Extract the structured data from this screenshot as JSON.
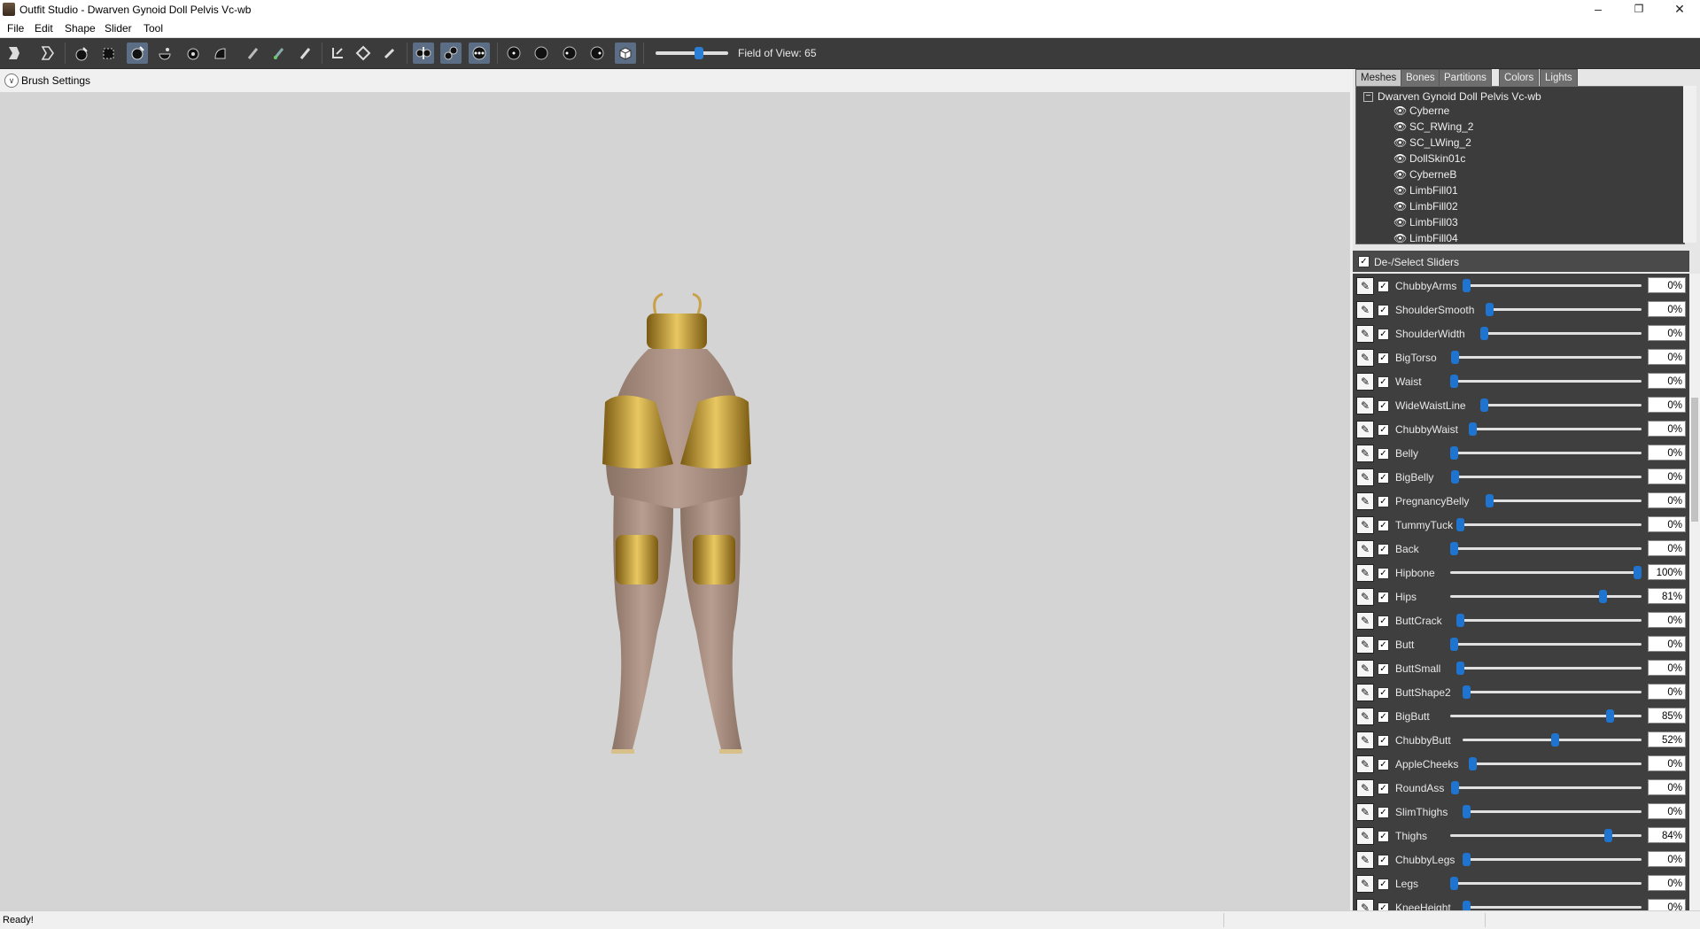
{
  "window": {
    "title": "Outfit Studio - Dwarven Gynoid Doll Pelvis Vc-wb",
    "minimize": "–",
    "maximize": "❐",
    "close": "✕"
  },
  "menu": [
    "File",
    "Edit",
    "Shape",
    "Slider",
    "Tool"
  ],
  "toolbar": {
    "fov_label": "Field of View: 65",
    "fov_value": 65,
    "tools": [
      "new-project-icon",
      "open-project-icon",
      "select-icon",
      "mask-icon",
      "inflate-icon",
      "deflate-icon",
      "move-brush-icon",
      "smooth-icon",
      "weight-paint-icon",
      "color-paint-icon",
      "alpha-paint-icon",
      "transform-icon",
      "pivot-icon",
      "vertex-select-icon",
      "x-mirror-icon",
      "connected-icon",
      "global-brush-icon",
      "wireframe-icon",
      "lighting-icon",
      "texture-icon",
      "shadeless-icon",
      "bone-view-icon"
    ]
  },
  "brush_settings_label": "Brush Settings",
  "tabs": [
    {
      "label": "Meshes",
      "active": true
    },
    {
      "label": "Bones",
      "active": false
    },
    {
      "label": "Partitions",
      "active": false
    },
    {
      "label": "Colors",
      "active": false
    },
    {
      "label": "Lights",
      "active": false
    }
  ],
  "mesh_tree": {
    "root": "Dwarven Gynoid Doll Pelvis Vc-wb",
    "items": [
      "Cyberne",
      "SC_RWing_2",
      "SC_LWing_2",
      "DollSkin01c",
      "CyberneB",
      "LimbFill01",
      "LimbFill02",
      "LimbFill03",
      "LimbFill04"
    ]
  },
  "sliders_header": "De-/Select Sliders",
  "sliders": [
    {
      "name": "ChubbyArms",
      "value": 0,
      "display": "0%"
    },
    {
      "name": "ShoulderSmooth",
      "value": 0,
      "display": "0%"
    },
    {
      "name": "ShoulderWidth",
      "value": 0,
      "display": "0%"
    },
    {
      "name": "BigTorso",
      "value": 0,
      "display": "0%"
    },
    {
      "name": "Waist",
      "value": 0,
      "display": "0%"
    },
    {
      "name": "WideWaistLine",
      "value": 0,
      "display": "0%"
    },
    {
      "name": "ChubbyWaist",
      "value": 0,
      "display": "0%"
    },
    {
      "name": "Belly",
      "value": 0,
      "display": "0%"
    },
    {
      "name": "BigBelly",
      "value": 0,
      "display": "0%"
    },
    {
      "name": "PregnancyBelly",
      "value": 0,
      "display": "0%"
    },
    {
      "name": "TummyTuck",
      "value": 0,
      "display": "0%"
    },
    {
      "name": "Back",
      "value": 0,
      "display": "0%"
    },
    {
      "name": "Hipbone",
      "value": 100,
      "display": "100%"
    },
    {
      "name": "Hips",
      "value": 81,
      "display": "81%"
    },
    {
      "name": "ButtCrack",
      "value": 0,
      "display": "0%"
    },
    {
      "name": "Butt",
      "value": 0,
      "display": "0%"
    },
    {
      "name": "ButtSmall",
      "value": 0,
      "display": "0%"
    },
    {
      "name": "ButtShape2",
      "value": 0,
      "display": "0%"
    },
    {
      "name": "BigButt",
      "value": 85,
      "display": "85%"
    },
    {
      "name": "ChubbyButt",
      "value": 52,
      "display": "52%"
    },
    {
      "name": "AppleCheeks",
      "value": 0,
      "display": "0%"
    },
    {
      "name": "RoundAss",
      "value": 0,
      "display": "0%"
    },
    {
      "name": "SlimThighs",
      "value": 0,
      "display": "0%"
    },
    {
      "name": "Thighs",
      "value": 84,
      "display": "84%"
    },
    {
      "name": "ChubbyLegs",
      "value": 0,
      "display": "0%"
    },
    {
      "name": "Legs",
      "value": 0,
      "display": "0%"
    },
    {
      "name": "KneeHeight",
      "value": 0,
      "display": "0%"
    }
  ],
  "status": "Ready!"
}
